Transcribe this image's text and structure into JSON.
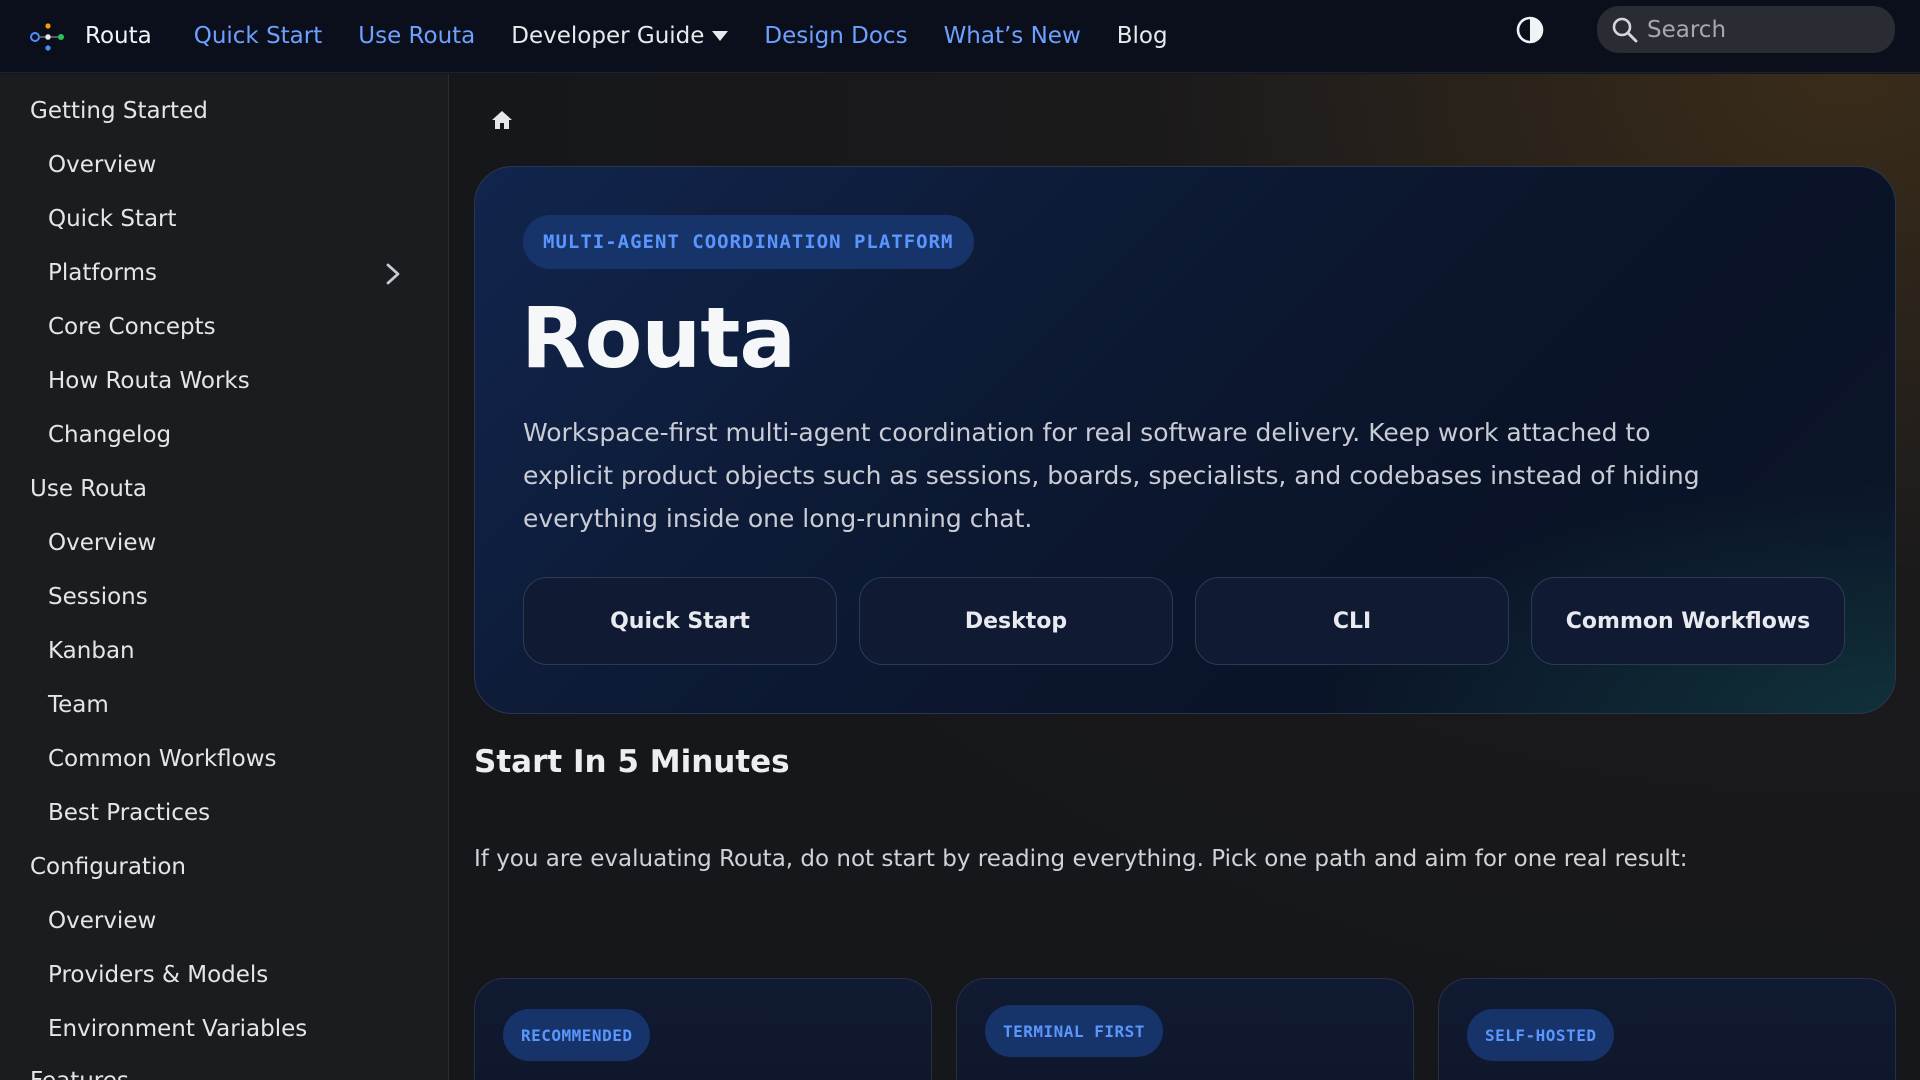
{
  "nav": {
    "brand": "Routa",
    "links": [
      "Quick Start",
      "Use Routa",
      "Developer Guide",
      "Design Docs",
      "What’s New",
      "Blog"
    ],
    "theme_toggle_icon": "contrast-icon",
    "search_placeholder": "Search"
  },
  "sidebar": {
    "sections": [
      {
        "title": "Getting Started",
        "items": [
          "Overview",
          "Quick Start",
          "Platforms",
          "Core Concepts",
          "How Routa Works",
          "Changelog"
        ]
      },
      {
        "title": "Use Routa",
        "items": [
          "Overview",
          "Sessions",
          "Kanban",
          "Team",
          "Common Workflows",
          "Best Practices"
        ]
      },
      {
        "title": "Configuration",
        "items": [
          "Overview",
          "Providers & Models",
          "Environment Variables"
        ]
      },
      {
        "title": "Features",
        "items": []
      }
    ]
  },
  "hero": {
    "badge": "MULTI-AGENT COORDINATION PLATFORM",
    "title": "Routa",
    "description": "Workspace-first multi-agent coordination for real software delivery. Keep work attached to explicit product objects such as sessions, boards, specialists, and codebases instead of hiding everything inside one long-running chat.",
    "buttons": [
      "Quick Start",
      "Desktop",
      "CLI",
      "Common Workflows"
    ]
  },
  "start": {
    "title": "Start In 5 Minutes",
    "description": "If you are evaluating Routa, do not start by reading everything. Pick one path and aim for one real result:",
    "cards": [
      {
        "badge": "RECOMMENDED"
      },
      {
        "badge": "TERMINAL FIRST"
      },
      {
        "badge": "SELF-HOSTED"
      }
    ]
  },
  "colors": {
    "accent": "#6ea0ff",
    "nav_bg": "#0b0f1c",
    "sidebar_bg": "#1b1c20",
    "badge_bg": "#16336a"
  }
}
